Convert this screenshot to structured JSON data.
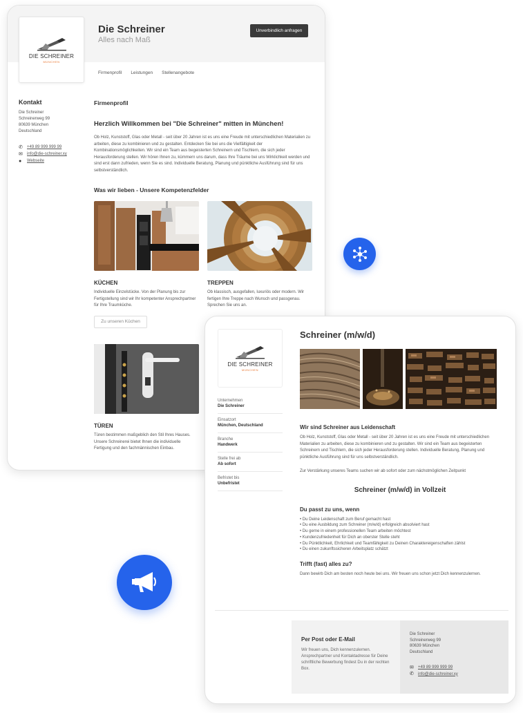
{
  "brand": {
    "logo_word": "DIE SCHREINER",
    "logo_sub": "MÜNCHEN",
    "accent": "#2563eb",
    "logo_accent": "#e8732c"
  },
  "profile": {
    "title": "Die Schreiner",
    "subtitle": "Alles nach Maß",
    "cta": "Unverbindlich anfragen",
    "nav": [
      "Firmenprofil",
      "Leistungen",
      "Stellenangebote"
    ],
    "contact": {
      "heading": "Kontakt",
      "address": [
        "Die Schreiner",
        "Schreinerweg 99",
        "80639 München",
        "Deutschland"
      ],
      "phone": "+49 89 999 999 99",
      "email": "info@die-schreiner.xy",
      "website": "Webseite"
    },
    "section_label": "Firmenprofil",
    "welcome_heading": "Herzlich Willkommen bei \"Die Schreiner\" mitten in München!",
    "welcome_text": "Ob Holz, Kunststoff, Glas oder Metall - seit über 20 Jahren ist es uns eine Freude mit unterschiedlichen Materialien zu arbeiten, diese zu kombinieren und zu gestalten. Entdecken Sie bei uns die Vielfältigkeit der Kombinationsmöglichkeiten. Wir sind ein Team aus begeisterten Schreinern und Tischlern, die sich jeder Herausforderung stellen. Wir hören Ihnen zu, kümmern uns darum, dass Ihre Träume bei uns Wirklichkeit werden und sind erst dann zufrieden, wenn Sie es sind. Individuelle Beratung, Planung und pünktliche Ausführung sind für uns selbstverständlich.",
    "competences_heading": "Was wir lieben - Unsere Kompetenzfelder",
    "tiles": [
      {
        "title": "KÜCHEN",
        "text": "Individuelle Einzelstücke. Von der Planung bis zur Fertigstellung sind wir Ihr kompetenter Ansprechpartner für Ihre Traumküche.",
        "button": "Zu unseren Küchen"
      },
      {
        "title": "TREPPEN",
        "text": "Ob klassisch, ausgefallen, luxuriös oder modern. Wir fertigen Ihre Treppe nach Wunsch und passgenau. Sprechen Sie uns an.",
        "button": ""
      },
      {
        "title": "TÜREN",
        "text": "Türen bestimmen maßgeblich den Stil Ihres Hauses. Unsere Schreinerei bietet Ihnen die individuelle Fertigung und den fachmännischen Einbau.",
        "button": ""
      }
    ]
  },
  "job": {
    "title": "Schreiner (m/w/d)",
    "info": [
      {
        "label": "Unternehmen",
        "value": "Die Schreiner"
      },
      {
        "label": "Einsatzort",
        "value": "München, Deutschland"
      },
      {
        "label": "Branche",
        "value": "Handwerk"
      },
      {
        "label": "Stelle frei ab",
        "value": "Ab sofort"
      },
      {
        "label": "Befristet bis",
        "value": "Unbefristet"
      }
    ],
    "about_heading": "Wir sind Schreiner aus Leidenschaft",
    "about_text": "Ob Holz, Kunststoff, Glas oder Metall - seit über 20 Jahren ist es uns eine Freude mit unterschiedlichen Materialien zu arbeiten, diese zu kombinieren und zu gestalten. Wir sind ein Team aus begeisterten Schreinern und Tischlern, die sich jeder Herausforderung stellen. Individuelle Beratung, Planung und pünktliche Ausführung sind für uns selbstverständlich.",
    "seeking_text": "Zur Verstärkung unseres Teams suchen wir ab sofort oder zum nächstmöglichen Zeitpunkt",
    "position_heading": "Schreiner (m/w/d) in Vollzeit",
    "fit_heading": "Du passt zu uns, wenn",
    "fit_list": [
      "Du Deine Leidenschaft zum Beruf gemacht hast",
      "Du eine Ausbildung zum Schreiner (m/w/d) erfolgreich absolviert hast",
      "Du gerne in einem professionellen Team arbeiten möchtest",
      "Kundenzufriedenheit für Dich an oberster Stelle steht",
      "Du Pünktlichkeit, Ehrlichkeit und Teamfähigkeit zu Deinen Charaktereigenschaften zählst",
      "Du einen zukunftssicheren Arbeitsplatz schätzt"
    ],
    "match_heading": "Trifft (fast) alles zu?",
    "match_text": "Dann bewirb Dich am besten noch heute bei uns. Wir freuen uns schon jetzt Dich kennenzulernen.",
    "footer": {
      "heading": "Per Post oder E-Mail",
      "text": "Wir freuen uns, Dich kennenzulernen. Ansprechpartner und Kontaktadresse für Deine schriftliche Bewerbung findest Du in der rechten Box.",
      "address": [
        "Die Schreiner",
        "Schreinerweg 99",
        "80639 München",
        "Deutschland"
      ],
      "phone": "+49 89 999 999 99",
      "email": "info@die-schreiner.xy"
    }
  }
}
